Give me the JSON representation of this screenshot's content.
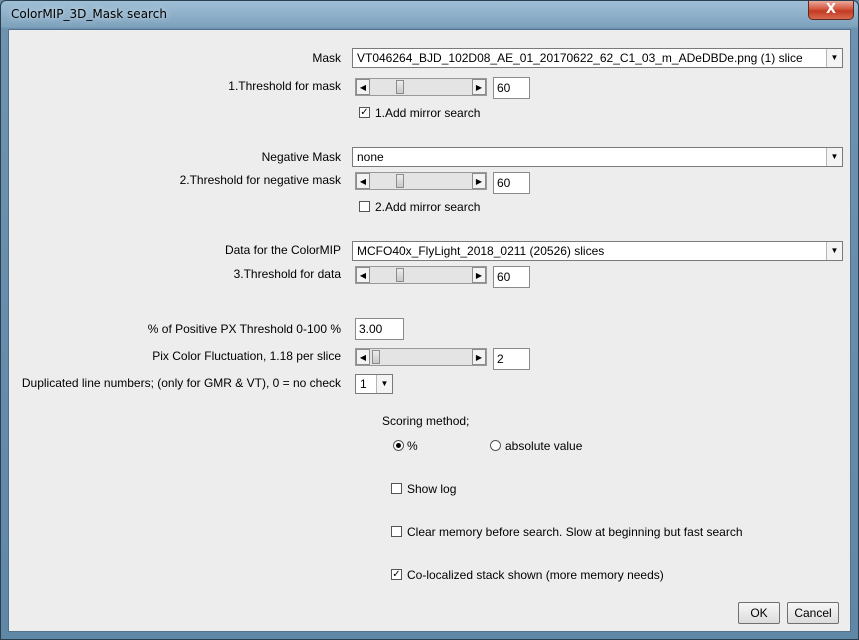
{
  "window": {
    "title": "ColorMIP_3D_Mask search",
    "close_glyph": "X"
  },
  "mask": {
    "label": "Mask",
    "value": "VT046264_BJD_102D08_AE_01_20170622_62_C1_03_m_ADeDBDe.png  (1) slice",
    "threshold_label": "1.Threshold for mask",
    "threshold_value": "60",
    "mirror_label": "1.Add mirror search",
    "mirror_checked": true
  },
  "negative_mask": {
    "label": "Negative Mask",
    "value": "none",
    "threshold_label": "2.Threshold for negative mask",
    "threshold_value": "60",
    "mirror_label": "2.Add mirror search",
    "mirror_checked": false
  },
  "data": {
    "label": "Data for the ColorMIP",
    "value": "MCFO40x_FlyLight_2018_0211  (20526) slices",
    "threshold_label": "3.Threshold for data",
    "threshold_value": "60"
  },
  "positive_px": {
    "label": "% of Positive PX Threshold 0-100 %",
    "value": "3.00"
  },
  "fluctuation": {
    "label": "Pix Color Fluctuation, 1.18 per slice",
    "value": "2"
  },
  "duplicated": {
    "label": "Duplicated line numbers; (only for GMR & VT), 0 = no check",
    "value": "1"
  },
  "scoring": {
    "label": "Scoring method;",
    "options": [
      "%",
      "absolute value"
    ],
    "selected": "%"
  },
  "options": {
    "show_log": {
      "label": "Show log",
      "checked": false
    },
    "clear_memory": {
      "label": "Clear memory before search. Slow at beginning but fast search",
      "checked": false
    },
    "colocalized": {
      "label": "Co-localized stack shown (more memory needs)",
      "checked": true
    }
  },
  "buttons": {
    "ok": "OK",
    "cancel": "Cancel"
  },
  "glyphs": {
    "check": "✓",
    "arrow_down": "▼",
    "arrow_left": "◀",
    "arrow_right": "▶"
  }
}
